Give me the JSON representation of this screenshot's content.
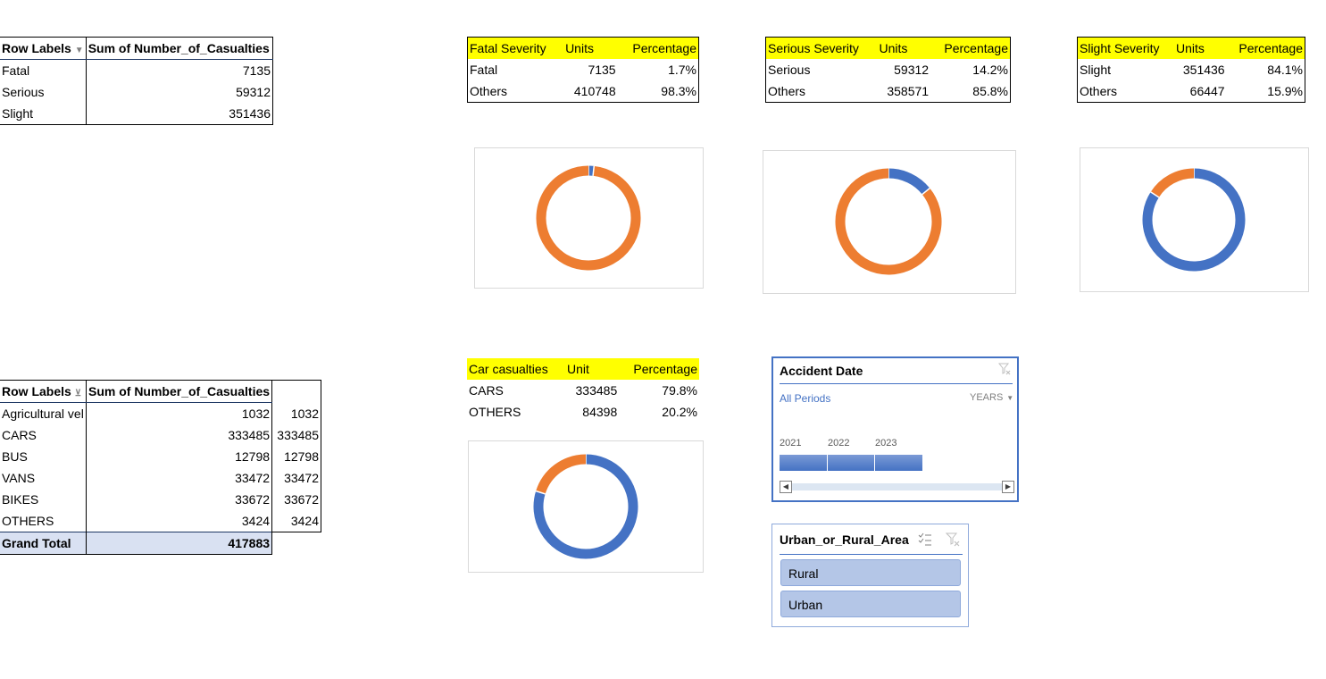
{
  "pivot1": {
    "header_row_labels": "Row Labels",
    "header_sum": "Sum of Number_of_Casualties",
    "rows": [
      {
        "label": "Fatal",
        "value": "7135"
      },
      {
        "label": "Serious",
        "value": "59312"
      },
      {
        "label": "Slight",
        "value": "351436"
      }
    ]
  },
  "fatal_table": {
    "headers": [
      "Fatal Severity",
      "Units",
      "Percentage"
    ],
    "rows": [
      {
        "label": "Fatal",
        "units": "7135",
        "pct": "1.7%"
      },
      {
        "label": "Others",
        "units": "410748",
        "pct": "98.3%"
      }
    ]
  },
  "serious_table": {
    "headers": [
      "Serious Severity",
      "Units",
      "Percentage"
    ],
    "rows": [
      {
        "label": "Serious",
        "units": "59312",
        "pct": "14.2%"
      },
      {
        "label": "Others",
        "units": "358571",
        "pct": "85.8%"
      }
    ]
  },
  "slight_table": {
    "headers": [
      "Slight Severity",
      "Units",
      "Percentage"
    ],
    "rows": [
      {
        "label": "Slight",
        "units": "351436",
        "pct": "84.1%"
      },
      {
        "label": "Others",
        "units": "66447",
        "pct": "15.9%"
      }
    ]
  },
  "pivot2": {
    "header_row_labels": "Row Labels",
    "header_sum": "Sum of Number_of_Casualties",
    "rows": [
      {
        "label": "Agricultural vel",
        "value": "1032",
        "extra": "1032"
      },
      {
        "label": "CARS",
        "value": "333485",
        "extra": "333485"
      },
      {
        "label": "BUS",
        "value": "12798",
        "extra": "12798"
      },
      {
        "label": "VANS",
        "value": "33472",
        "extra": "33472"
      },
      {
        "label": "BIKES",
        "value": "33672",
        "extra": "33672"
      },
      {
        "label": "OTHERS",
        "value": "3424",
        "extra": "3424"
      }
    ],
    "grand_total_label": "Grand Total",
    "grand_total_value": "417883"
  },
  "car_table": {
    "headers": [
      "Car casualties",
      "Unit",
      "Percentage"
    ],
    "rows": [
      {
        "label": "CARS",
        "units": "333485",
        "pct": "79.8%"
      },
      {
        "label": "OTHERS",
        "units": "84398",
        "pct": "20.2%"
      }
    ]
  },
  "timeline": {
    "title": "Accident Date",
    "period": "All Periods",
    "level": "YEARS",
    "years": [
      "2021",
      "2022",
      "2023"
    ],
    "icon_filter_clear": "clear-filter-icon"
  },
  "area_slicer": {
    "title": "Urban_or_Rural_Area",
    "items": [
      "Rural",
      "Urban"
    ],
    "icon_multiselect": "multi-select-icon",
    "icon_filter_clear": "clear-filter-icon"
  },
  "colors": {
    "blue": "#4472c4",
    "orange": "#ed7d31",
    "yellow": "#ffff00",
    "slicer_item": "#b4c6e7"
  },
  "chart_data": [
    {
      "type": "pie",
      "name": "Fatal Severity",
      "labels": [
        "Fatal",
        "Others"
      ],
      "values": [
        7135,
        410748
      ],
      "colors": [
        "#4472c4",
        "#ed7d31"
      ],
      "hole": true
    },
    {
      "type": "pie",
      "name": "Serious Severity",
      "labels": [
        "Serious",
        "Others"
      ],
      "values": [
        59312,
        358571
      ],
      "colors": [
        "#4472c4",
        "#ed7d31"
      ],
      "hole": true
    },
    {
      "type": "pie",
      "name": "Slight Severity",
      "labels": [
        "Slight",
        "Others"
      ],
      "values": [
        351436,
        66447
      ],
      "colors": [
        "#4472c4",
        "#ed7d31"
      ],
      "hole": true
    },
    {
      "type": "pie",
      "name": "Car casualties",
      "labels": [
        "CARS",
        "OTHERS"
      ],
      "values": [
        333485,
        84398
      ],
      "colors": [
        "#4472c4",
        "#ed7d31"
      ],
      "hole": true
    }
  ]
}
